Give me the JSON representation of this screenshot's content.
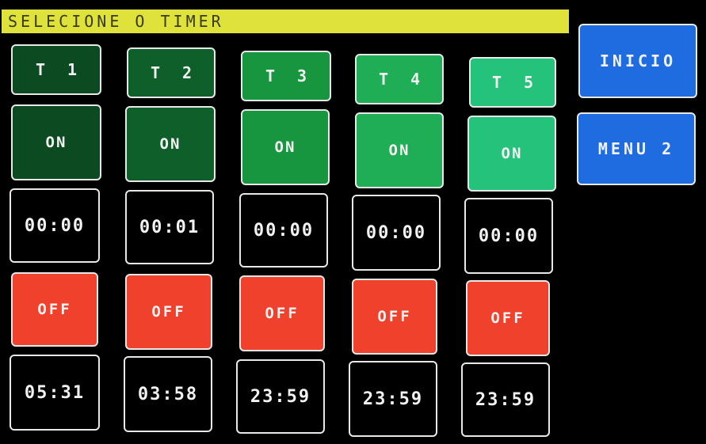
{
  "header": {
    "title": "SELECIONE O TIMER"
  },
  "side_menu": {
    "inicio_label": "INICIO",
    "menu2_label": "MENU 2"
  },
  "colors": {
    "title_bg": "#dfe23a",
    "off": "#f0412c",
    "menu_button": "#1f6be0",
    "timer_shades": [
      "#0c4a22",
      "#0f5f2a",
      "#18963f",
      "#1fae55",
      "#24c27a"
    ]
  },
  "timers": [
    {
      "label": "T 1",
      "on_label": "ON",
      "on_time": "00:00",
      "off_label": "OFF",
      "off_time": "05:31"
    },
    {
      "label": "T 2",
      "on_label": "ON",
      "on_time": "00:01",
      "off_label": "OFF",
      "off_time": "03:58"
    },
    {
      "label": "T 3",
      "on_label": "ON",
      "on_time": "00:00",
      "off_label": "OFF",
      "off_time": "23:59"
    },
    {
      "label": "T 4",
      "on_label": "ON",
      "on_time": "00:00",
      "off_label": "OFF",
      "off_time": "23:59"
    },
    {
      "label": "T 5",
      "on_label": "ON",
      "on_time": "00:00",
      "off_label": "OFF",
      "off_time": "23:59"
    }
  ]
}
